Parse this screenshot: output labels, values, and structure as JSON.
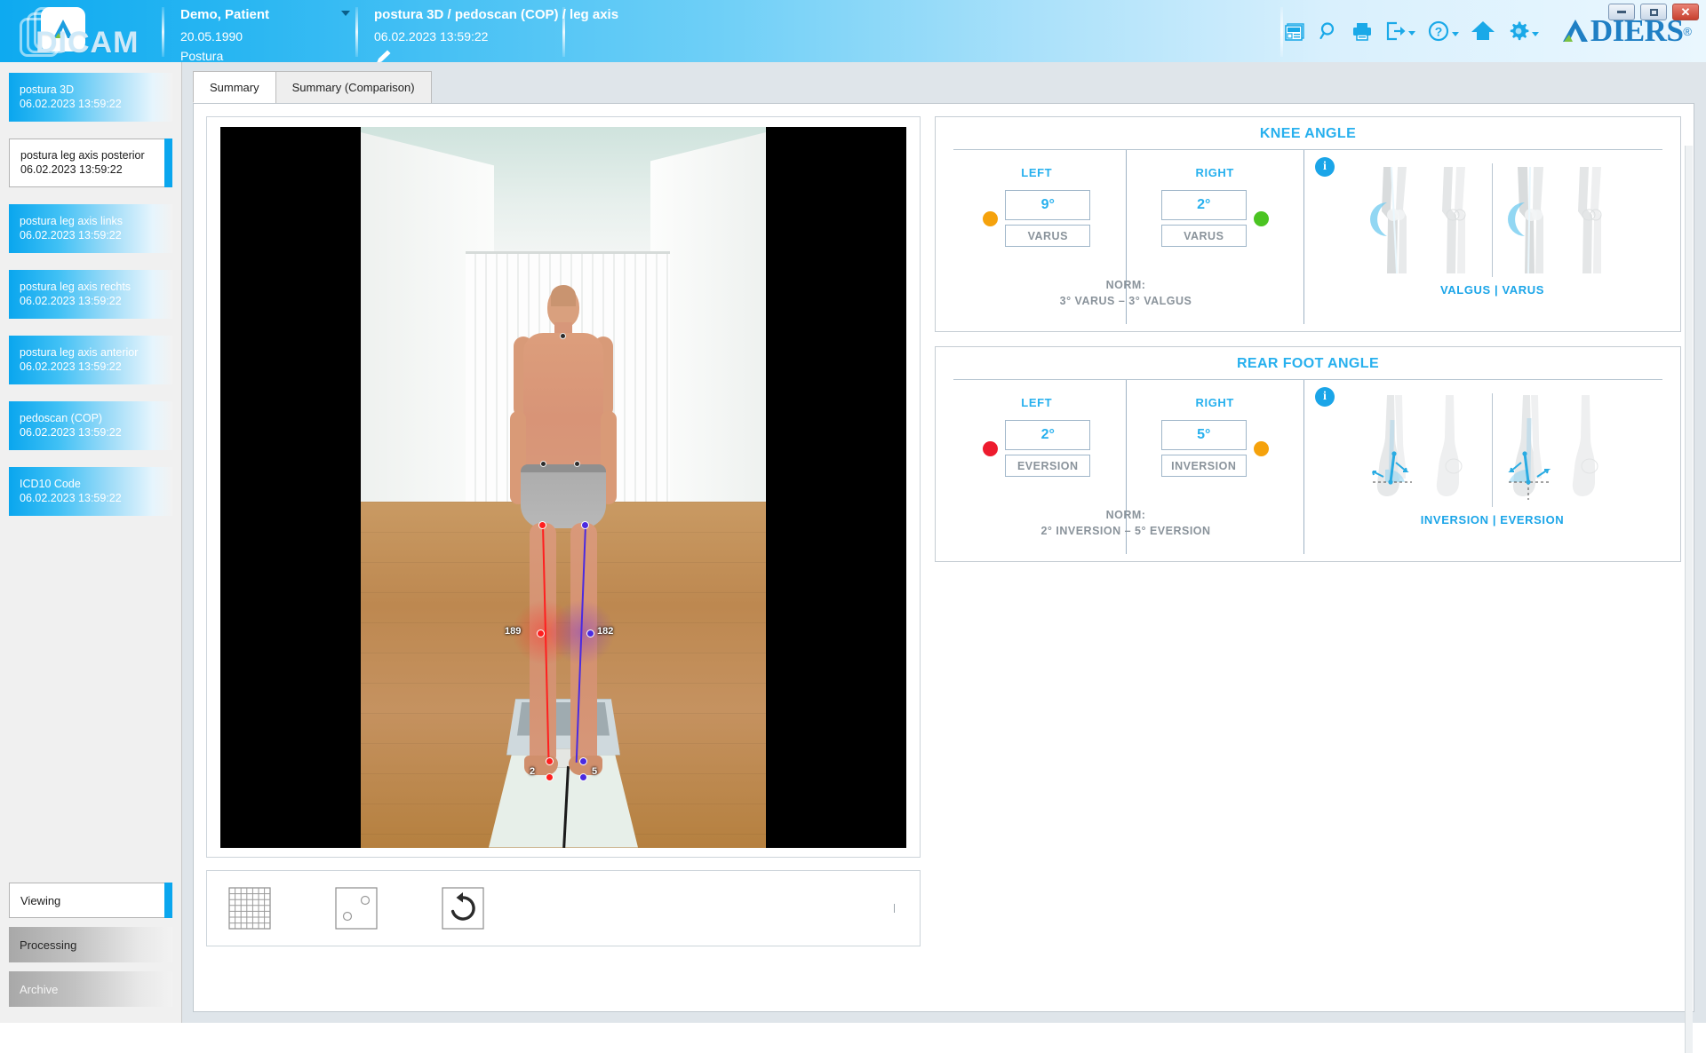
{
  "app": {
    "name": "DICAM",
    "brand": "DIERS",
    "brand_reg": "®",
    "accent": "#27b0ee",
    "header_blue": "#29b6f2"
  },
  "header": {
    "patient": {
      "name": "Demo, Patient",
      "birthdate": "20.05.1990",
      "module": "Postura"
    },
    "study": {
      "title": "postura 3D / pedoscan (COP) / leg axis",
      "datetime": "06.02.2023 13:59:22"
    },
    "icons": [
      {
        "name": "news-icon",
        "label": "NEWS"
      },
      {
        "name": "search-icon",
        "label": "Search"
      },
      {
        "name": "print-icon",
        "label": "Print"
      },
      {
        "name": "export-icon",
        "label": "Export"
      },
      {
        "name": "help-icon",
        "label": "Help"
      },
      {
        "name": "home-icon",
        "label": "Home"
      },
      {
        "name": "settings-icon",
        "label": "Settings"
      }
    ],
    "window_controls": {
      "minimize": "–",
      "maximize": "□",
      "close": "✕"
    }
  },
  "sidebar": {
    "studies": [
      {
        "name": "postura 3D",
        "date": "06.02.2023 13:59:22",
        "selected": false
      },
      {
        "name": "postura leg axis posterior",
        "date": "06.02.2023 13:59:22",
        "selected": true
      },
      {
        "name": "postura leg axis links",
        "date": "06.02.2023 13:59:22",
        "selected": false
      },
      {
        "name": "postura leg axis rechts",
        "date": "06.02.2023 13:59:22",
        "selected": false
      },
      {
        "name": "postura leg axis anterior",
        "date": "06.02.2023 13:59:22",
        "selected": false
      },
      {
        "name": "pedoscan (COP)",
        "date": "06.02.2023 13:59:22",
        "selected": false
      },
      {
        "name": "ICD10 Code",
        "date": "06.02.2023 13:59:22",
        "selected": false
      }
    ],
    "modes": [
      {
        "label": "Viewing",
        "active": true
      },
      {
        "label": "Processing",
        "active": false
      },
      {
        "label": "Archive",
        "active": false
      }
    ]
  },
  "tabs": [
    {
      "label": "Summary",
      "active": true
    },
    {
      "label": "Summary (Comparison)",
      "active": false
    }
  ],
  "viewer": {
    "annotations": {
      "left_knee_value": "189",
      "right_knee_value": "182",
      "left_ankle_value": "2",
      "right_ankle_value": "5",
      "left_line_color": "#ff1f1f",
      "right_line_color": "#4b2ae0"
    },
    "tools": [
      {
        "name": "grid-icon",
        "label": "Grid overlay"
      },
      {
        "name": "markers-icon",
        "label": "Markers"
      },
      {
        "name": "reset-rotate-icon",
        "label": "Reset view"
      }
    ]
  },
  "metrics": [
    {
      "title": "KNEE ANGLE",
      "left": {
        "label": "LEFT",
        "value": "9°",
        "direction": "VARUS",
        "status_color": "#f5a20c"
      },
      "right": {
        "label": "RIGHT",
        "value": "2°",
        "direction": "VARUS",
        "status_color": "#4bc422"
      },
      "norm_label": "NORM:",
      "norm_value": "3° VARUS – 3° VALGUS",
      "illustration_caption": "VALGUS | VARUS",
      "illustration_kind": "knee",
      "info_label": "i"
    },
    {
      "title": "REAR FOOT ANGLE",
      "left": {
        "label": "LEFT",
        "value": "2°",
        "direction": "EVERSION",
        "status_color": "#ed1b2e"
      },
      "right": {
        "label": "RIGHT",
        "value": "5°",
        "direction": "INVERSION",
        "status_color": "#f5a20c"
      },
      "norm_label": "NORM:",
      "norm_value": "2° INVERSION – 5° EVERSION",
      "illustration_caption": "INVERSION | EVERSION",
      "illustration_kind": "foot",
      "info_label": "i"
    }
  ]
}
